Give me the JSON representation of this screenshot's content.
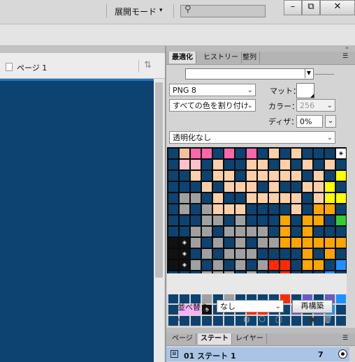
{
  "titlebar": {
    "mode_label": "展開モード",
    "mode_caret": "▾",
    "search_placeholder": "",
    "minimize": "–",
    "restore": "⧉",
    "close": "✕"
  },
  "document": {
    "page_label": "ページ 1",
    "canvas_color": "#0c4371"
  },
  "optimize_panel": {
    "tabs": [
      "最適化",
      "ヒストリー",
      "整列"
    ],
    "active_tab": 0,
    "format": "PNG 8",
    "palette": "すべての色を割り付け",
    "matte_label": "マット：",
    "colors_label": "カラー：",
    "colors_value": "256",
    "dither_label": "ディザ：",
    "dither_value": "0%",
    "transparency": "透明化なし",
    "sort_label": "並べ替え：",
    "sort_value": "なし",
    "rebuild_label": "再構築",
    "color_table": [
      [
        "#0c4371",
        "#f5c09a",
        "#ff66aa",
        "#ff66aa",
        "#0c4371",
        "#ff66aa",
        "#0c4371",
        "#ff66aa",
        "#0c4371",
        "#ffd0a8",
        "#0c4371",
        "#ffd0a8",
        "#0c4371",
        "#0c4371",
        "#0c4371",
        "#ffffff"
      ],
      [
        "#0c4371",
        "#ffc0c8",
        "#ffc0c8",
        "#0c4371",
        "#ffd0a8",
        "#0c4371",
        "#0c4371",
        "#ffd0a8",
        "#ffd0a8",
        "#0c4371",
        "#ffd0a8",
        "#0c4371",
        "#ffd0a8",
        "#0c4371",
        "#ffd0a8",
        "#0c4371"
      ],
      [
        "#0c4371",
        "#0c4371",
        "#ffd0a8",
        "#0c4371",
        "#ffd0a8",
        "#ffd0a8",
        "#0c4371",
        "#ffd0a8",
        "#ffd0a8",
        "#ffd0a8",
        "#ffd0a8",
        "#ffd0a8",
        "#0c4371",
        "#ffd0a8",
        "#0c4371",
        "#ffff00"
      ],
      [
        "#0c4371",
        "#0c4371",
        "#0c4371",
        "#ffd0a8",
        "#0c4371",
        "#ffd0a8",
        "#ffd0a8",
        "#ffd0a8",
        "#0c4371",
        "#ffd0a8",
        "#0c4371",
        "#0c4371",
        "#ffd0a8",
        "#ffd0a8",
        "#ffff00",
        "#0c4371"
      ],
      [
        "#0c4371",
        "#a0a0a0",
        "#a0a0a0",
        "#0c4371",
        "#ffd0a8",
        "#0c4371",
        "#0c4371",
        "#ffd0a8",
        "#ffd0a8",
        "#ffd0a8",
        "#ffd0a8",
        "#ffd0a8",
        "#0c4371",
        "#ffd0a8",
        "#ffff00",
        "#ffff00"
      ],
      [
        "#0c4371",
        "#a0a0a0",
        "#0c4371",
        "#a0a0a0",
        "#ffd0a8",
        "#ffd0a8",
        "#ffd0a8",
        "#0c4371",
        "#0c4371",
        "#0c4371",
        "#0c4371",
        "#ffd0a8",
        "#0c4371",
        "#ffa500",
        "#ffa500",
        "#0c4371"
      ],
      [
        "#0c4371",
        "#0c4371",
        "#0c4371",
        "#a0a0a0",
        "#a0a0a0",
        "#0c4371",
        "#a0a0a0",
        "#0c4371",
        "#0c4371",
        "#0c4371",
        "#ffa500",
        "#0c4371",
        "#ffa500",
        "#ffa500",
        "#0c4371",
        "#32cd32"
      ],
      [
        "#0c4371",
        "#0c4371",
        "#a0a0a0",
        "#a0a0a0",
        "#0c4371",
        "#a0a0a0",
        "#a0a0a0",
        "#a0a0a0",
        "#a0a0a0",
        "#0c4371",
        "#ffa500",
        "#0c4371",
        "#ffa500",
        "#0c4371",
        "#0c4371",
        "#0c4371"
      ],
      [
        "#111111",
        "#111111",
        "#a0a0a0",
        "#0c4371",
        "#a0a0a0",
        "#0c4371",
        "#a0a0a0",
        "#0c4371",
        "#a0a0a0",
        "#a0a0a0",
        "#ffa500",
        "#ffa500",
        "#ffa500",
        "#ffa500",
        "#ffa500",
        "#ffa500"
      ],
      [
        "#111111",
        "#111111",
        "#0c4371",
        "#a0a0a0",
        "#0c4371",
        "#a0a0a0",
        "#a0a0a0",
        "#a0a0a0",
        "#0c4371",
        "#0c4371",
        "#0c4371",
        "#0c4371",
        "#ffa500",
        "#0c4371",
        "#ffa500",
        "#0c4371"
      ],
      [
        "#111111",
        "#111111",
        "#a0a0a0",
        "#0c4371",
        "#a0a0a0",
        "#0c4371",
        "#a0a0a0",
        "#0c4371",
        "#a0a0a0",
        "#ff2a00",
        "#ff2a00",
        "#0c4371",
        "#ffa500",
        "#ffa500",
        "#0c4371",
        "#1e90ff"
      ],
      [
        "#0c4371",
        "#0c4371",
        "#0c4371",
        "#a0a0a0",
        "#a0a0a0",
        "#a0a0a0",
        "#0c4371",
        "#a0a0a0",
        "#0c4371",
        "#0c4371",
        "#ff2a00",
        "#0c4371",
        "#0c4371",
        "#0c4371",
        "#1e90ff",
        "#0c4371"
      ],
      [
        "#0c4371",
        "#a0a0a0",
        "#a0a0a0",
        "#0c4371",
        "#a0a0a0",
        "#0c4371",
        "#a0a0a0",
        "#a0a0a0",
        "#0c4371",
        "#ff2a00",
        "#ff2a00",
        "#ff2a00",
        "#0c4371",
        "#6a5acd",
        "#0c4371",
        "#1e90ff"
      ],
      [
        "#0c4371",
        "#0c4371",
        "#0c4371",
        "#a0a0a0",
        "#0c4371",
        "#a0a0a0",
        "#0c4371",
        "#0c4371",
        "#0c4371",
        "#0c4371",
        "#ff2a00",
        "#0c4371",
        "#6a5acd",
        "#0c4371",
        "#6a5acd",
        "#1e90ff"
      ],
      [
        "#0c4371",
        "#ffaaff",
        "#ffaaff",
        "#111111",
        "#0c4371",
        "#0c4371",
        "#0c4371",
        "#ff2a00",
        "#ff2a00",
        "#0c4371",
        "#0c4371",
        "#6a5acd",
        "#0c4371",
        "#6a5acd",
        "#1e90ff",
        "#0c4371"
      ],
      [
        "#0c4371",
        "#0c4371",
        "#0c4371",
        "#0c4371",
        "#0c4371",
        "#0c4371",
        "#0c4371",
        "#0c4371",
        "#0c4371",
        "#0c4371",
        "#0c4371",
        "#0c4371",
        "#0c4371",
        "#0c4371",
        "#0c4371",
        "#0c4371"
      ]
    ],
    "locked_cells": [
      "0-15",
      "8-1",
      "9-1",
      "10-1",
      "14-3"
    ]
  },
  "states_panel": {
    "tabs": [
      "ページ",
      "ステート",
      "レイヤー"
    ],
    "active_tab": 1,
    "row_label": "01  ステート 1",
    "row_count": "7"
  }
}
